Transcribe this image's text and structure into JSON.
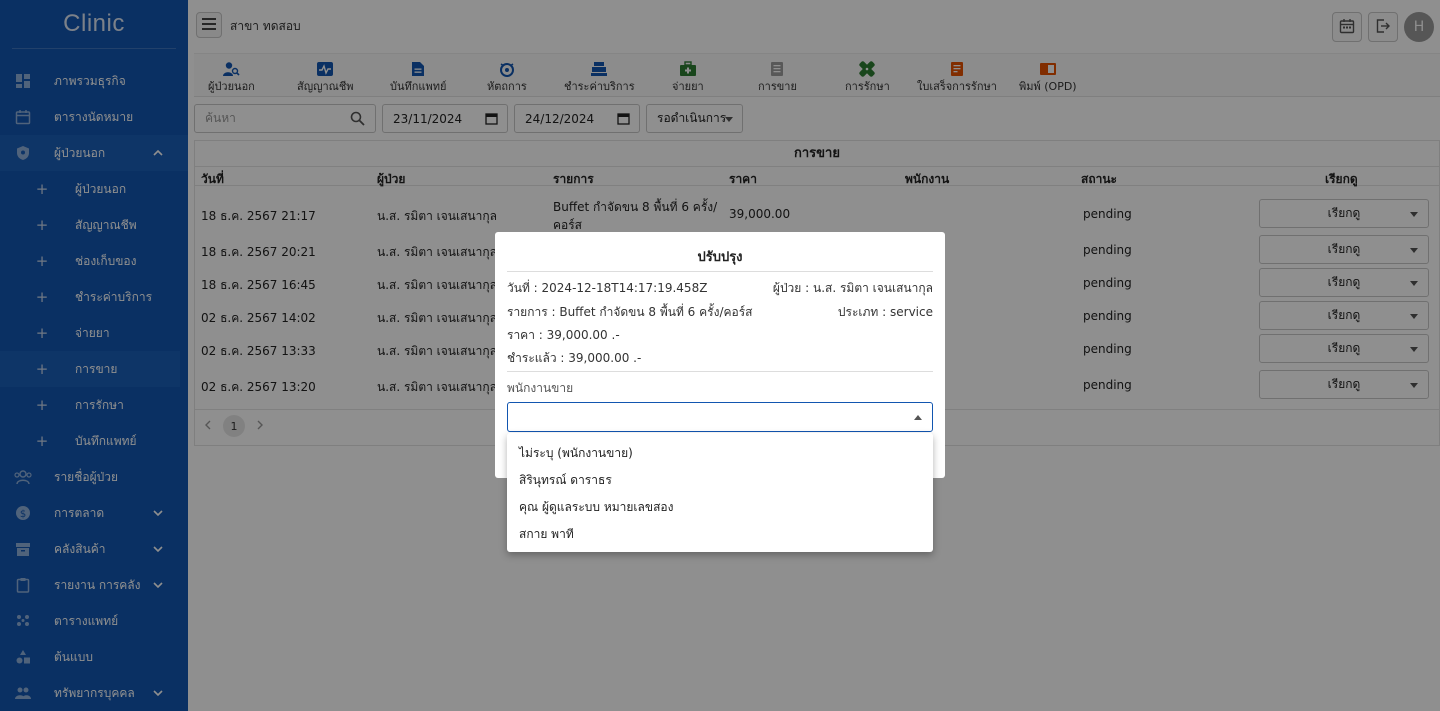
{
  "app": {
    "logo": "Clinic",
    "branch": "สาขา ทดสอบ",
    "avatar_letter": "H"
  },
  "sidebar": {
    "items": [
      {
        "label": "ภาพรวมธุรกิจ",
        "icon": "dashboard-icon"
      },
      {
        "label": "ตารางนัดหมาย",
        "icon": "calendar-icon"
      },
      {
        "label": "ผู้ป่วยนอก",
        "icon": "shield-icon",
        "expanded": true
      },
      {
        "label": "รายชื่อผู้ป่วย",
        "icon": "patients-icon"
      },
      {
        "label": "การตลาด",
        "icon": "dollar-icon",
        "has_children": true
      },
      {
        "label": "คลังสินค้า",
        "icon": "archive-icon",
        "has_children": true
      },
      {
        "label": "รายงาน การคลัง",
        "icon": "clipboard-icon",
        "has_children": true
      },
      {
        "label": "ตารางแพทย์",
        "icon": "doctors-icon"
      },
      {
        "label": "ต้นแบบ",
        "icon": "shapes-icon"
      },
      {
        "label": "ทรัพยากรบุคคล",
        "icon": "people-icon",
        "has_children": true
      }
    ],
    "sub_items": [
      {
        "label": "ผู้ป่วยนอก"
      },
      {
        "label": "สัญญาณชีพ"
      },
      {
        "label": "ช่องเก็บของ"
      },
      {
        "label": "ชำระค่าบริการ"
      },
      {
        "label": "จ่ายยา"
      },
      {
        "label": "การขาย",
        "active": true
      },
      {
        "label": "การรักษา"
      },
      {
        "label": "บันทึกแพทย์"
      }
    ]
  },
  "toolbar": {
    "tools": [
      {
        "label": "ผู้ป่วยนอก",
        "icon": "person-search-icon",
        "color": "#1256b0"
      },
      {
        "label": "สัญญาณชีพ",
        "icon": "vital-signs-icon",
        "color": "#1256b0"
      },
      {
        "label": "บันทึกแพทย์",
        "icon": "document-icon",
        "color": "#1256b0"
      },
      {
        "label": "หัตถการ",
        "icon": "procedure-icon",
        "color": "#1256b0"
      },
      {
        "label": "ชำระค่าบริการ",
        "icon": "cashier-icon",
        "color": "#1256b0"
      },
      {
        "label": "จ่ายยา",
        "icon": "medicine-kit-icon",
        "color": "#2e7d32"
      },
      {
        "label": "การขาย",
        "icon": "sales-doc-icon",
        "color": "#9e9e9e"
      },
      {
        "label": "การรักษา",
        "icon": "bandage-icon",
        "color": "#2e7d32"
      },
      {
        "label": "ใบเสร็จการรักษา",
        "icon": "receipt-icon",
        "color": "#e65100"
      },
      {
        "label": "พิมพ์ (OPD)",
        "icon": "print-opd-icon",
        "color": "#e65100"
      }
    ]
  },
  "filters": {
    "search_placeholder": "ค้นหา",
    "date_from": "23/11/2024",
    "date_to": "24/12/2024",
    "status": "รอดำเนินการ"
  },
  "table": {
    "title": "การขาย",
    "headers": [
      "วันที่",
      "ผู้ป่วย",
      "รายการ",
      "ราคา",
      "พนักงาน",
      "สถานะ",
      "เรียกดู"
    ],
    "rows": [
      {
        "date": "18 ธ.ค. 2567 21:17",
        "patient": "น.ส. รมิตา เจนเสนากุล",
        "item": "Buffet กำจัดขน 8 พื้นที่ 6 ครั้ง/",
        "item2": "คอร์ส",
        "price": "39,000.00",
        "status": "pending",
        "action": "เรียกดู"
      },
      {
        "date": "18 ธ.ค. 2567 20:21",
        "patient": "น.ส. รมิตา เจนเสนากุล",
        "item": "",
        "item2": "",
        "price": "",
        "status": "pending",
        "action": "เรียกดู"
      },
      {
        "date": "18 ธ.ค. 2567 16:45",
        "patient": "น.ส. รมิตา เจนเสนากุล",
        "item": "",
        "item2": "",
        "price": "",
        "status": "pending",
        "action": "เรียกดู"
      },
      {
        "date": "02 ธ.ค. 2567 14:02",
        "patient": "น.ส. รมิตา เจนเสนากุล",
        "item": "",
        "item2": "",
        "price": "",
        "status": "pending",
        "action": "เรียกดู"
      },
      {
        "date": "02 ธ.ค. 2567 13:33",
        "patient": "น.ส. รมิตา เจนเสนากุล",
        "item": "",
        "item2": "",
        "price": "",
        "status": "pending",
        "action": "เรียกดู"
      },
      {
        "date": "02 ธ.ค. 2567 13:20",
        "patient": "น.ส. รมิตา เจนเสนากุล",
        "item": "",
        "item2": "",
        "price": "",
        "status": "pending",
        "action": "เรียกดู"
      }
    ],
    "page": "1"
  },
  "modal": {
    "title": "ปรับปรุง",
    "date": "วันที่ : 2024-12-18T14:17:19.458Z",
    "patient": "ผู้ป่วย : น.ส. รมิตา เจนเสนากุล",
    "item": "รายการ : Buffet กำจัดขน 8 พื้นที่ 6 ครั้ง/คอร์ส",
    "type": "ประเภท : service",
    "price": "ราคา : 39,000.00 .-",
    "paid": "ชำระแล้ว : 39,000.00 .-",
    "salesperson_label": "พนักงานขาย",
    "salesperson_value": "",
    "options": [
      "ไม่ระบุ (พนักงานขาย)",
      "สิรินุทรณ์ ดาราธร",
      "คุณ ผู้ดูแลระบบ หมายเลขสอง",
      "สกาย พาที"
    ]
  }
}
